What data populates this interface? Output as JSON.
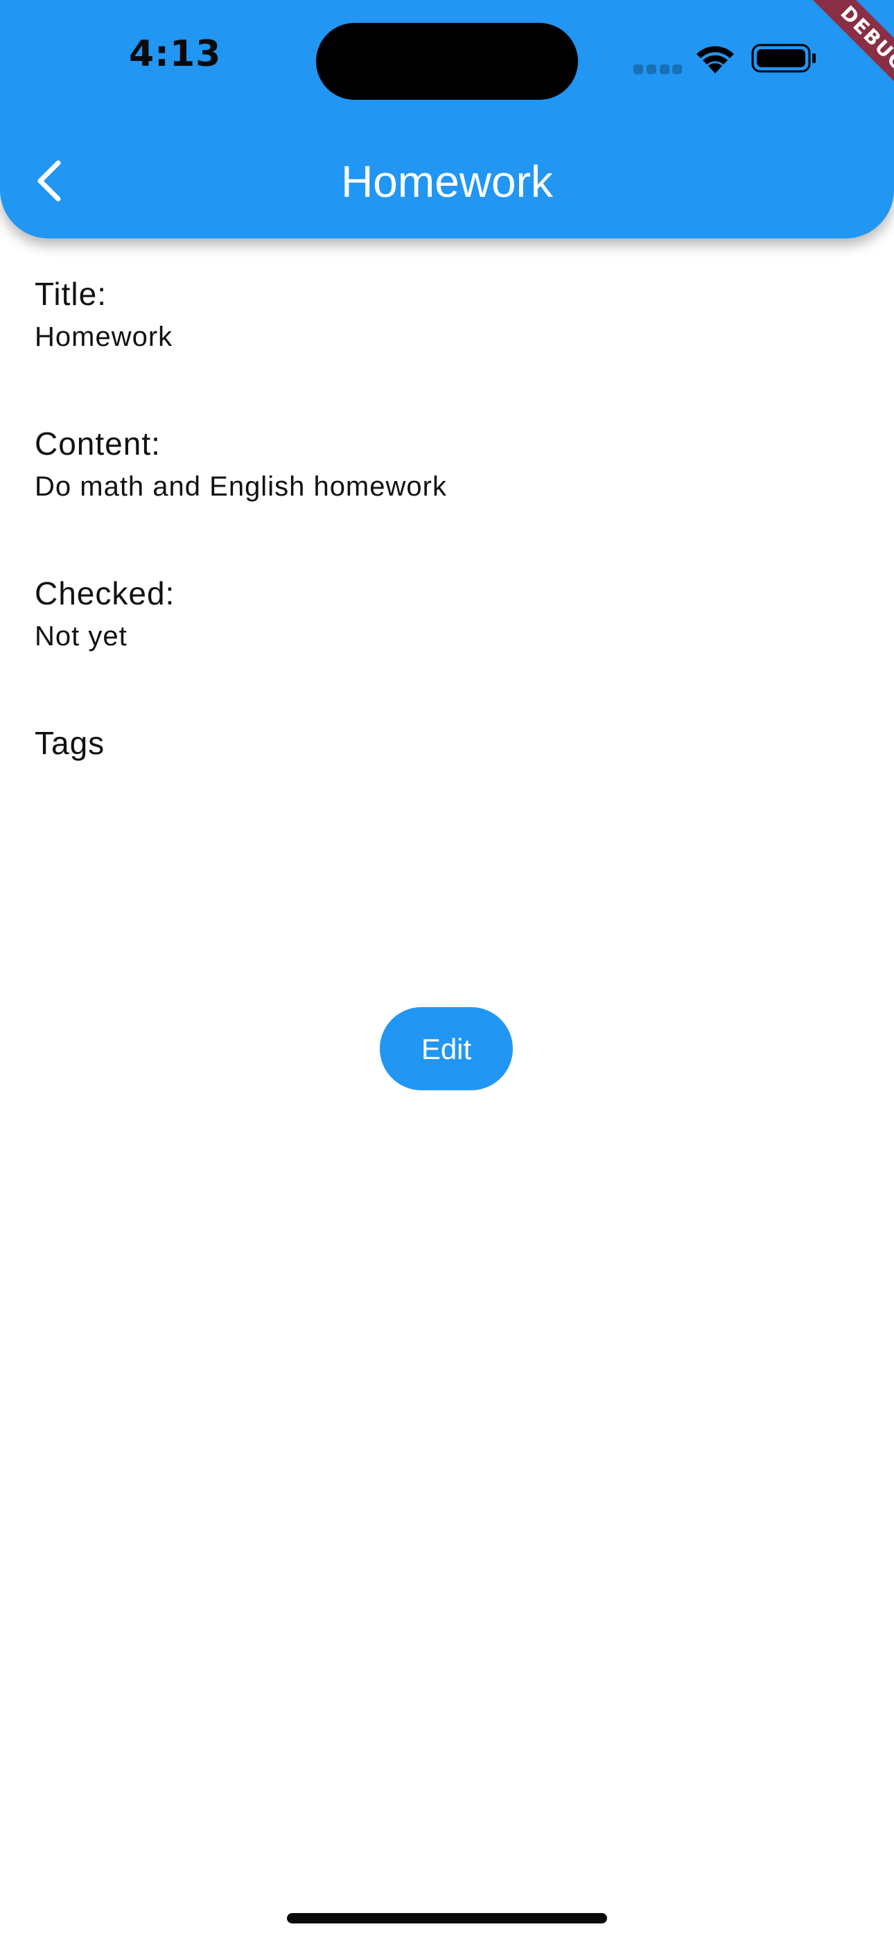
{
  "status_bar": {
    "time": "4:13"
  },
  "debug_banner": "DEBUG",
  "app_bar": {
    "title": "Homework",
    "back_icon": "chevron-left-icon"
  },
  "fields": {
    "title": {
      "label": "Title:",
      "value": "Homework"
    },
    "content": {
      "label": "Content:",
      "value": "Do math and English homework"
    },
    "checked": {
      "label": "Checked:",
      "value": "Not yet"
    },
    "tags": {
      "label": "Tags"
    }
  },
  "actions": {
    "edit_label": "Edit"
  },
  "colors": {
    "accent": "#2196F3",
    "debug": "#8a2f45"
  }
}
